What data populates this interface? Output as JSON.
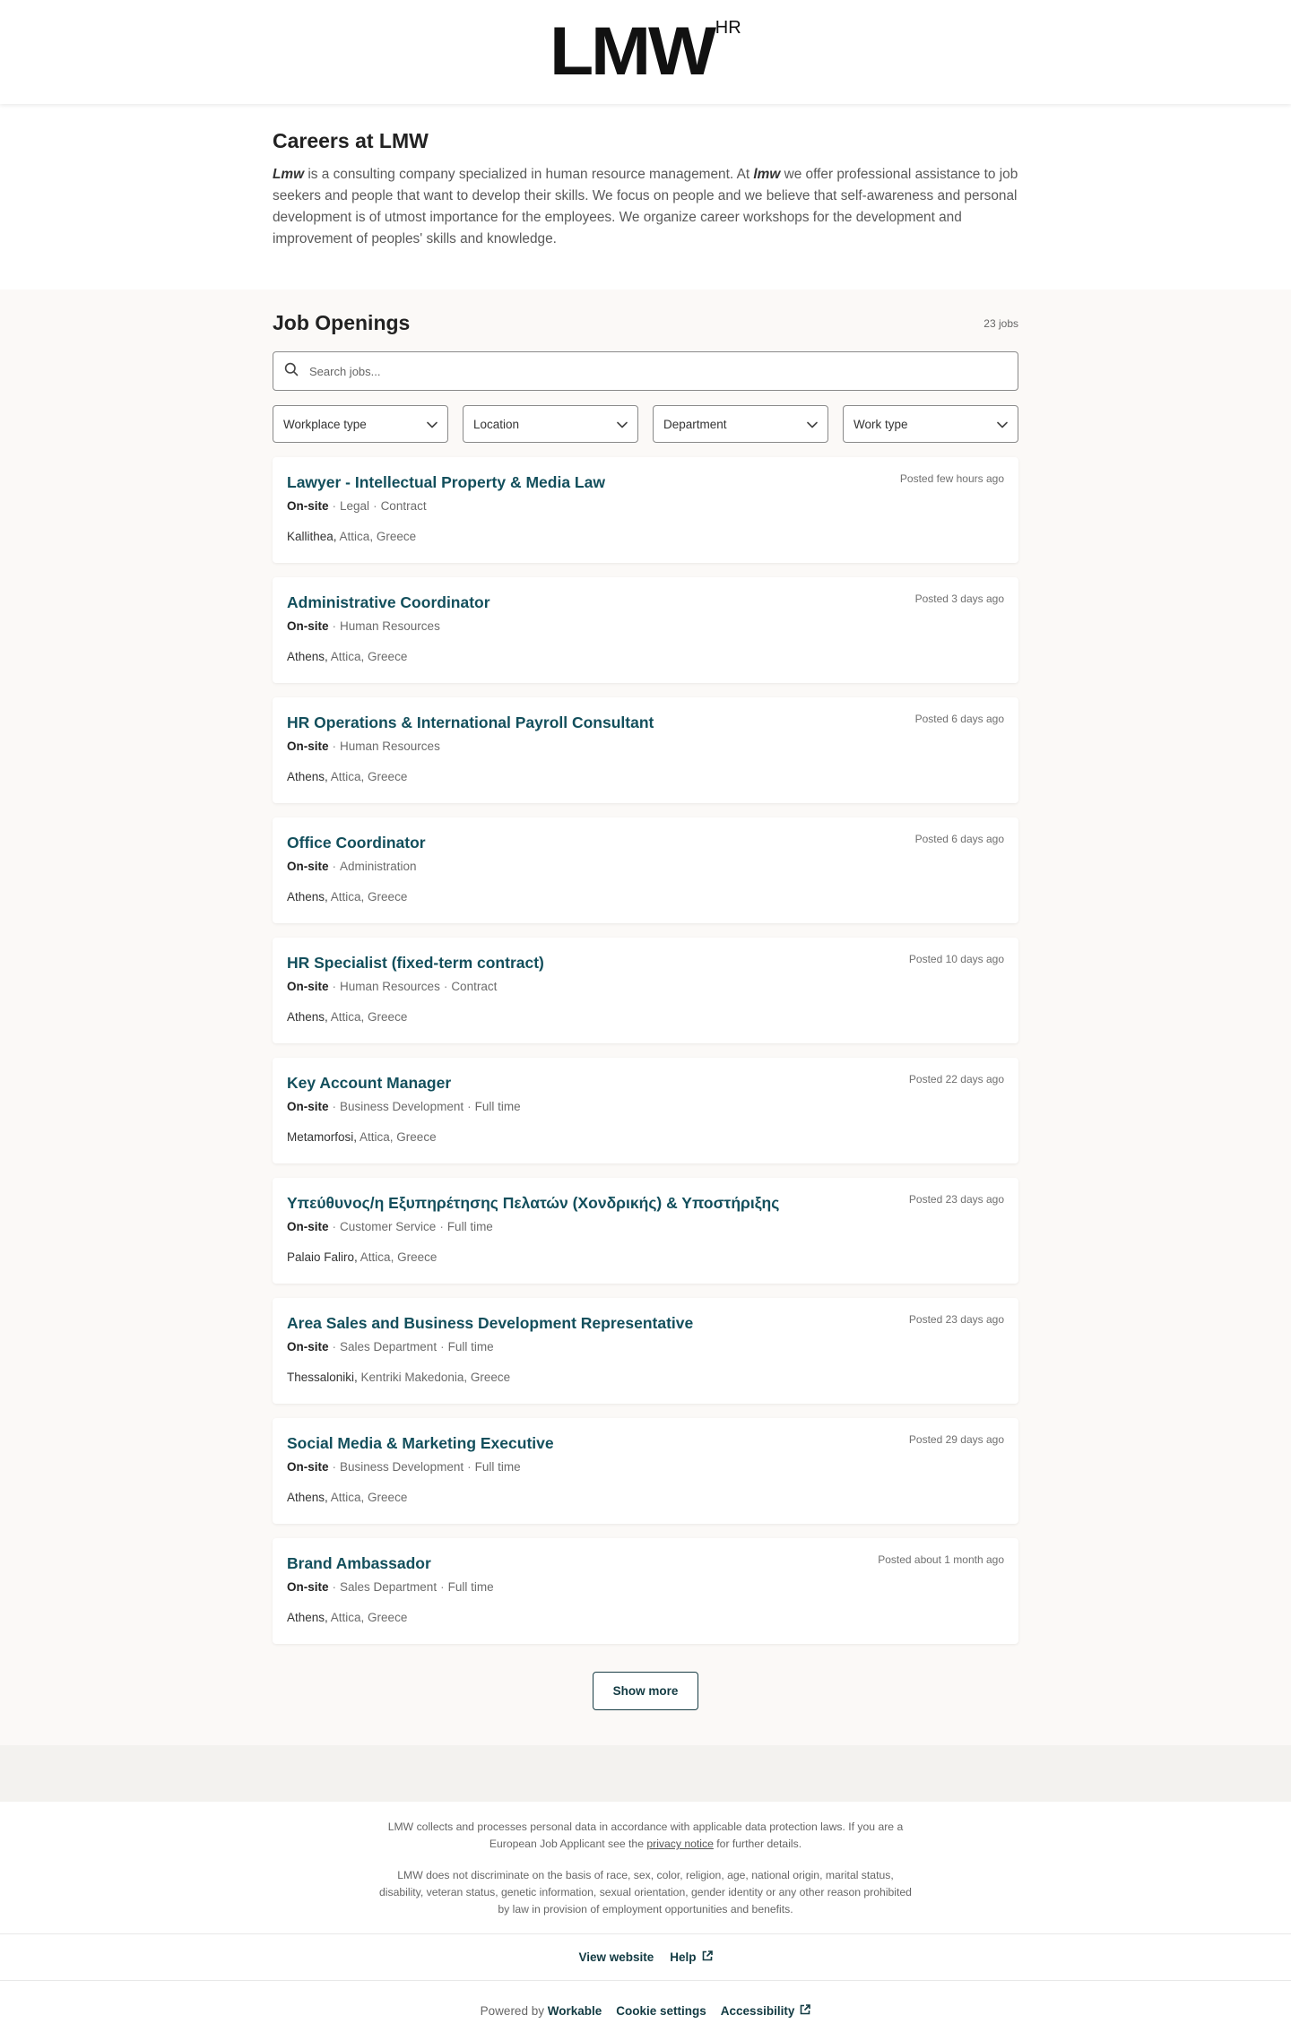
{
  "header": {
    "logo_main": "LMW",
    "logo_sup": "HR"
  },
  "about": {
    "title": "Careers at LMW",
    "brand_1": "Lmw",
    "text_1": " is a consulting company specialized in human resource management. At ",
    "brand_2": "lmw",
    "text_2": " we offer professional assistance to job seekers and people that want to develop their skills. We focus on people and we believe that self-awareness and personal development is of utmost importance for the employees. We organize career workshops for the development and improvement of peoples' skills and knowledge."
  },
  "jobs": {
    "heading": "Job Openings",
    "count": "23 jobs",
    "search_placeholder": "Search jobs...",
    "filters": [
      "Workplace type",
      "Location",
      "Department",
      "Work type"
    ],
    "show_more": "Show more",
    "items": [
      {
        "title": "Lawyer - Intellectual Property & Media Law",
        "posted": "Posted few hours ago",
        "workplace": "On-site",
        "tags": [
          "Legal",
          "Contract"
        ],
        "city": "Kallithea,",
        "region": " Attica, Greece"
      },
      {
        "title": "Administrative Coordinator",
        "posted": "Posted 3 days ago",
        "workplace": "On-site",
        "tags": [
          "Human Resources"
        ],
        "city": "Athens,",
        "region": " Attica, Greece"
      },
      {
        "title": "HR Operations & International Payroll Consultant",
        "posted": "Posted 6 days ago",
        "workplace": "On-site",
        "tags": [
          "Human Resources"
        ],
        "city": "Athens,",
        "region": " Attica, Greece"
      },
      {
        "title": "Office Coordinator",
        "posted": "Posted 6 days ago",
        "workplace": "On-site",
        "tags": [
          "Administration"
        ],
        "city": "Athens,",
        "region": " Attica, Greece"
      },
      {
        "title": "HR Specialist (fixed-term contract)",
        "posted": "Posted 10 days ago",
        "workplace": "On-site",
        "tags": [
          "Human Resources",
          "Contract"
        ],
        "city": "Athens,",
        "region": " Attica, Greece"
      },
      {
        "title": "Key Account Manager",
        "posted": "Posted 22 days ago",
        "workplace": "On-site",
        "tags": [
          "Business Development",
          "Full time"
        ],
        "city": "Metamorfosi,",
        "region": " Attica, Greece"
      },
      {
        "title": "Υπεύθυνος/η Εξυπηρέτησης Πελατών (Χονδρικής) & Υποστήριξης",
        "posted": "Posted 23 days ago",
        "workplace": "On-site",
        "tags": [
          "Customer Service",
          "Full time"
        ],
        "city": "Palaio Faliro,",
        "region": " Attica, Greece"
      },
      {
        "title": "Area Sales and Business Development Representative",
        "posted": "Posted 23 days ago",
        "workplace": "On-site",
        "tags": [
          "Sales Department",
          "Full time"
        ],
        "city": "Thessaloniki,",
        "region": " Kentriki Makedonia, Greece"
      },
      {
        "title": "Social Media & Marketing Executive",
        "posted": "Posted 29 days ago",
        "workplace": "On-site",
        "tags": [
          "Business Development",
          "Full time"
        ],
        "city": "Athens,",
        "region": " Attica, Greece"
      },
      {
        "title": "Brand Ambassador",
        "posted": "Posted about 1 month ago",
        "workplace": "On-site",
        "tags": [
          "Sales Department",
          "Full time"
        ],
        "city": "Athens,",
        "region": " Attica, Greece"
      }
    ]
  },
  "footer": {
    "privacy_text_1": "LMW collects and processes personal data in accordance with applicable data protection laws. If you are a European Job Applicant see the ",
    "privacy_link": "privacy notice",
    "privacy_text_2": " for further details.",
    "eeo_text": "LMW does not discriminate on the basis of race, sex, color, religion, age, national origin, marital status, disability, veteran status, genetic information, sexual orientation, gender identity or any other reason prohibited by law in provision of employment opportunities and benefits.",
    "view_website": "View website",
    "help": "Help",
    "powered_prefix": "Powered by ",
    "powered_brand": "Workable",
    "cookie_settings": "Cookie settings",
    "accessibility": "Accessibility"
  },
  "icons": {
    "search": "search-icon",
    "chevron": "chevron-down-icon",
    "external": "external-link-icon"
  },
  "colors": {
    "accent": "#134f5c",
    "section_bg": "#fbf9f7"
  }
}
